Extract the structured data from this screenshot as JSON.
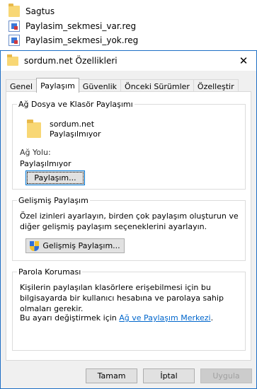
{
  "explorer": {
    "files": [
      {
        "name": "Sagtus",
        "icon": "folder-icon"
      },
      {
        "name": "Paylasim_sekmesi_var.reg",
        "icon": "registry-file-icon"
      },
      {
        "name": "Paylasim_sekmesi_yok.reg",
        "icon": "registry-file-icon"
      }
    ]
  },
  "dialog": {
    "title": "sordum.net Özellikleri",
    "close_glyph": "✕",
    "tabs": [
      "Genel",
      "Paylaşım",
      "Güvenlik",
      "Önceki Sürümler",
      "Özelleştir"
    ],
    "active_tab": "Paylaşım",
    "network_sharing": {
      "group_title": "Ağ Dosya ve Klasör Paylaşımı",
      "folder_name": "sordum.net",
      "folder_state": "Paylaşılmıyor",
      "path_label": "Ağ Yolu:",
      "path_value": "Paylaşılmıyor",
      "share_button": "Paylaşım..."
    },
    "advanced_sharing": {
      "group_title": "Gelişmiş Paylaşım",
      "description": "Özel izinleri ayarlayın, birden çok paylaşım oluşturun ve diğer gelişmiş paylaşım seçeneklerini ayarlayın.",
      "button": "Gelişmiş Paylaşım..."
    },
    "password_protection": {
      "group_title": "Parola Koruması",
      "description": "Kişilerin paylaşılan klasörlere erişebilmesi için bu bilgisayarda bir kullanıcı hesabına ve parolaya sahip olmaları gerekir.",
      "change_prefix": "Bu ayarı değiştirmek için",
      "link_text": "Ağ ve Paylaşım Merkezi",
      "change_suffix": "."
    },
    "buttons": {
      "ok": "Tamam",
      "cancel": "İptal",
      "apply": "Uygula"
    }
  },
  "colors": {
    "accent": "#0078d7",
    "link": "#0066cc",
    "dialog_bg": "#f0f0f0",
    "border": "#1e6fc5"
  }
}
